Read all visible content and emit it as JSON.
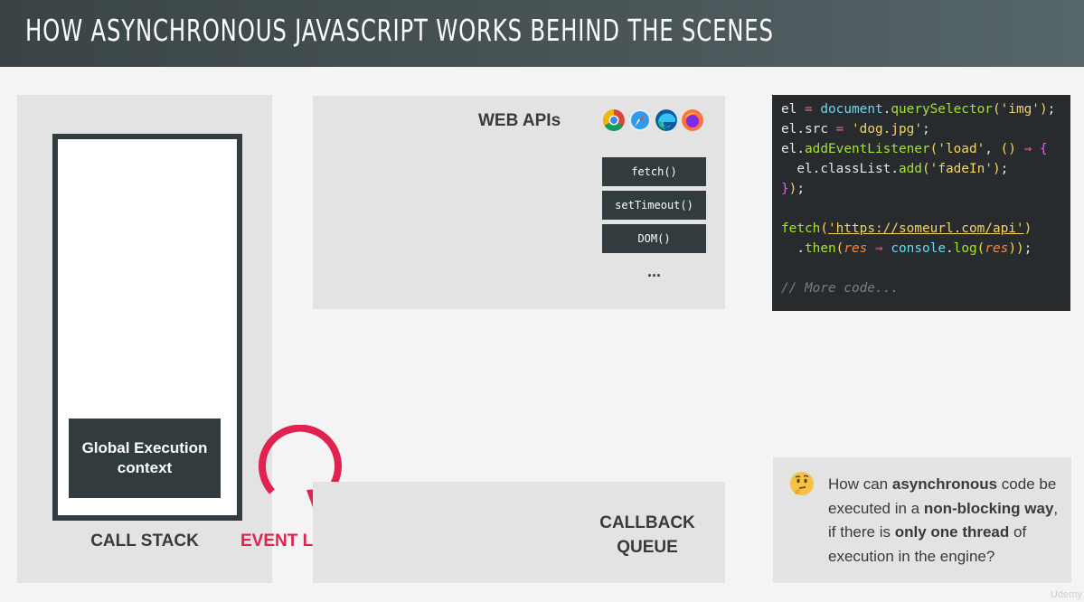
{
  "header": {
    "title": "HOW ASYNCHRONOUS JAVASCRIPT WORKS BEHIND THE SCENES"
  },
  "call_stack": {
    "frame_label": "Global Execution context",
    "label": "CALL STACK"
  },
  "event_loop": {
    "label": "EVENT LOOP"
  },
  "web_apis": {
    "title": "WEB APIs",
    "browser_icons": [
      "chrome-icon",
      "safari-icon",
      "edge-icon",
      "firefox-icon"
    ],
    "apis": [
      "fetch()",
      "setTimeout()",
      "DOM()"
    ],
    "more": "..."
  },
  "callback_queue": {
    "label_line1": "CALLBACK",
    "label_line2": "QUEUE"
  },
  "code": {
    "lines": [
      "el = document.querySelector('img');",
      "el.src = 'dog.jpg';",
      "el.addEventListener('load', () ⇒ {",
      "  el.classList.add('fadeIn');",
      "});",
      "",
      "fetch('https://someurl.com/api')",
      "  .then(res ⇒ console.log(res));",
      "",
      "// More code..."
    ]
  },
  "question": {
    "parts": [
      "How can ",
      "asynchronous",
      " code be executed in a ",
      "non-blocking way",
      ", if there is ",
      "only one thread",
      " of execution in the engine?"
    ],
    "icon": "thinking-face-icon"
  },
  "watermark": "Udemy",
  "colors": {
    "accent": "#e0234e",
    "dark": "#323b3d",
    "panel": "#e3e3e3"
  }
}
